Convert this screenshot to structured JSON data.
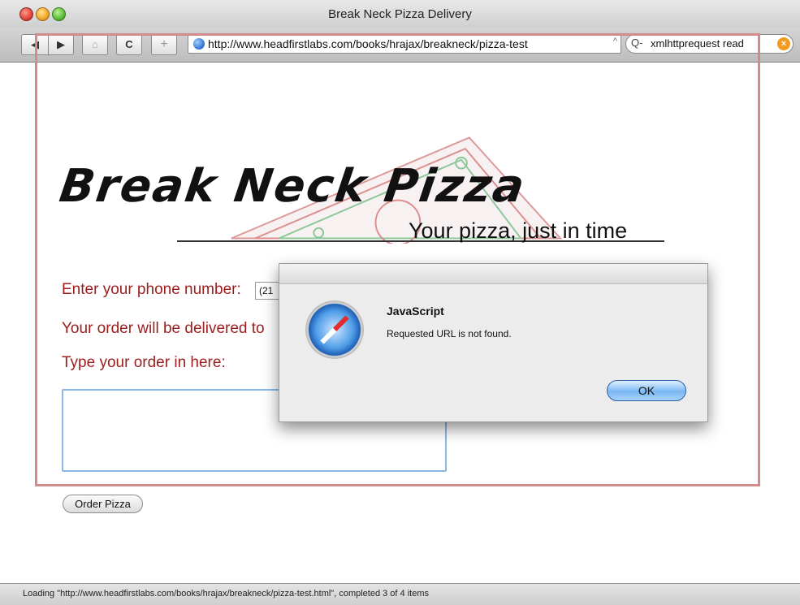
{
  "window": {
    "title": "Break Neck Pizza Delivery"
  },
  "toolbar": {
    "back_icon": "◀",
    "forward_icon": "▶",
    "home_icon": "⌂",
    "reload_icon": "C",
    "add_icon": "+",
    "url": "http://www.headfirstlabs.com/books/hrajax/breakneck/pizza-test",
    "url_snap_icon": "^",
    "search_icon": "Q-",
    "search_text": "xmlhttprequest read"
  },
  "page": {
    "logo": "Break Neck Pizza",
    "tagline": "Your pizza, just in time",
    "phone_label": "Enter your phone number:",
    "phone_value": "(21",
    "delivered_label": "Your order will be delivered to",
    "order_label": "Type your order in here:",
    "order_value": "",
    "order_button": "Order Pizza"
  },
  "dialog": {
    "title": "JavaScript",
    "message": "Requested URL is not found.",
    "ok_button": "OK"
  },
  "status": {
    "text": "Loading \"http://www.headfirstlabs.com/books/hrajax/breakneck/pizza-test.html\", completed 3 of 4 items"
  },
  "colors": {
    "accent": "#9b1d1d",
    "border": "#d38a8a",
    "ok_button": "#7ab8f3"
  }
}
